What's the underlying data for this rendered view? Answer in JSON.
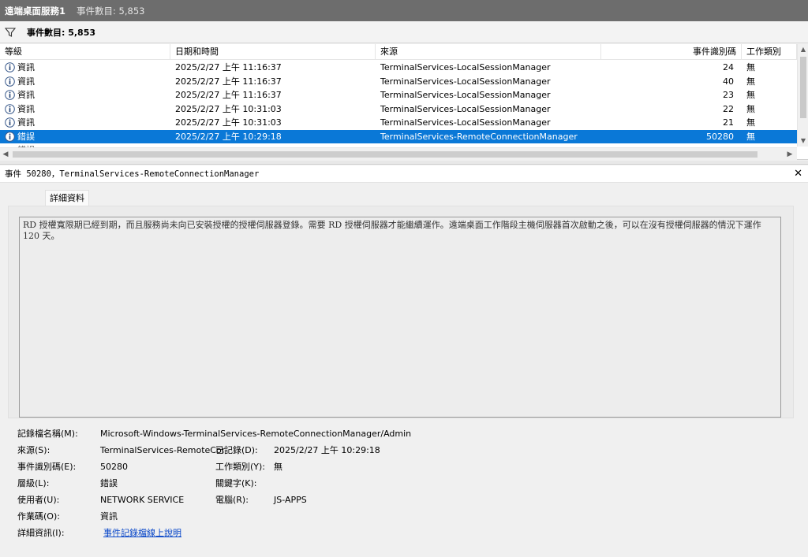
{
  "window": {
    "title": "遠端桌面服務1",
    "count_label": "事件數目: 5,853"
  },
  "filter": {
    "label": "事件數目: 5,853"
  },
  "columns": {
    "level": "等級",
    "date": "日期和時間",
    "source": "來源",
    "event_id": "事件識別碼",
    "task": "工作類別"
  },
  "events": [
    {
      "level": "資訊",
      "date": "2025/2/27 上午 11:16:37",
      "source": "TerminalServices-LocalSessionManager",
      "event_id": "24",
      "task": "無"
    },
    {
      "level": "資訊",
      "date": "2025/2/27 上午 11:16:37",
      "source": "TerminalServices-LocalSessionManager",
      "event_id": "40",
      "task": "無"
    },
    {
      "level": "資訊",
      "date": "2025/2/27 上午 11:16:37",
      "source": "TerminalServices-LocalSessionManager",
      "event_id": "23",
      "task": "無"
    },
    {
      "level": "資訊",
      "date": "2025/2/27 上午 10:31:03",
      "source": "TerminalServices-LocalSessionManager",
      "event_id": "22",
      "task": "無"
    },
    {
      "level": "資訊",
      "date": "2025/2/27 上午 10:31:03",
      "source": "TerminalServices-LocalSessionManager",
      "event_id": "21",
      "task": "無"
    },
    {
      "level": "錯誤",
      "date": "2025/2/27 上午 10:29:18",
      "source": "TerminalServices-RemoteConnectionManager",
      "event_id": "50280",
      "task": "無",
      "selected": true
    }
  ],
  "partial_row": {
    "level": "錯誤"
  },
  "detail": {
    "header": "事件 50280，TerminalServices-RemoteConnectionManager",
    "tab": "詳細資料",
    "message": "RD 授權寬限期已經到期，而且服務尚未向已安裝授權的授權伺服器登錄。需要 RD 授權伺服器才能繼續運作。遠端桌面工作階段主機伺服器首次啟動之後，可以在沒有授權伺服器的情況下運作 120 天。",
    "props": {
      "log_name_label": "記錄檔名稱(M):",
      "log_name": "Microsoft-Windows-TerminalServices-RemoteConnectionManager/Admin",
      "source_label": "來源(S):",
      "source": "TerminalServices-RemoteCor",
      "logged_label": "已記錄(D):",
      "logged": "2025/2/27 上午 10:29:18",
      "event_id_label": "事件識別碼(E):",
      "event_id": "50280",
      "task_label": "工作類別(Y):",
      "task": "無",
      "level_label": "層級(L):",
      "level": "錯誤",
      "keywords_label": "關鍵字(K):",
      "user_label": "使用者(U):",
      "user": "NETWORK SERVICE",
      "computer_label": "電腦(R):",
      "computer": "JS-APPS",
      "opcode_label": "作業碼(O):",
      "opcode": "資訊",
      "more_info_label": "詳細資訊(I):",
      "more_info_link": "事件記錄檔線上說明"
    }
  }
}
